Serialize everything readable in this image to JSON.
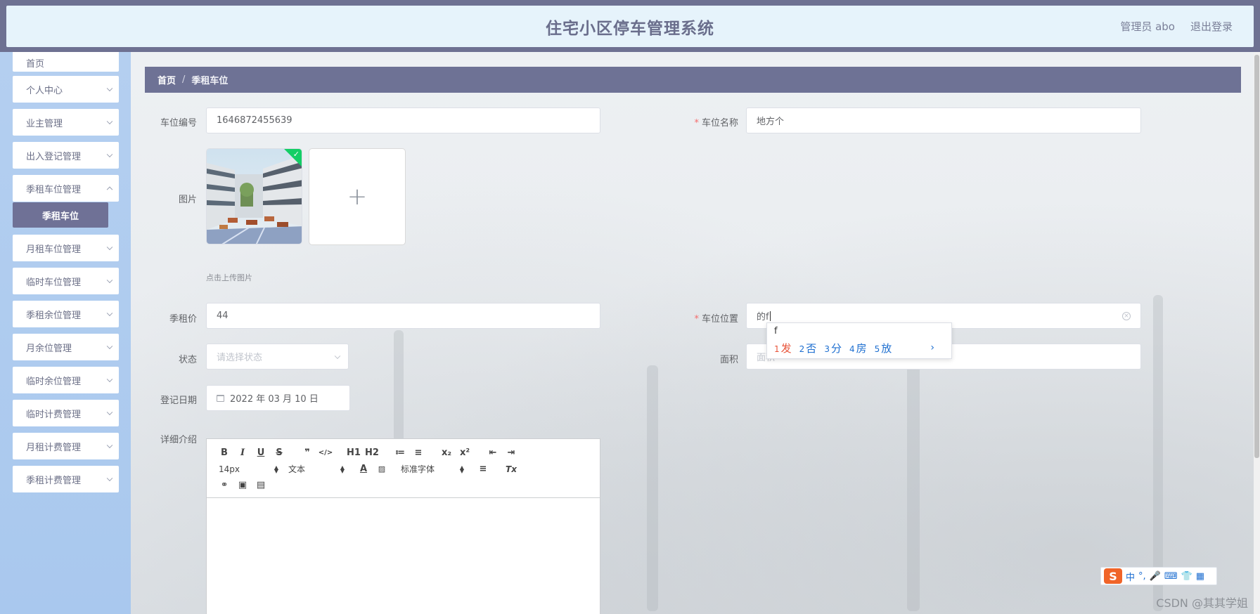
{
  "header": {
    "title": "住宅小区停车管理系统",
    "user_label": "管理员 abo",
    "logout_label": "退出登录"
  },
  "sidebar": {
    "items": [
      {
        "label": "首页"
      },
      {
        "label": "个人中心"
      },
      {
        "label": "业主管理"
      },
      {
        "label": "出入登记管理"
      },
      {
        "label": "季租车位管理"
      },
      {
        "label": "月租车位管理"
      },
      {
        "label": "临时车位管理"
      },
      {
        "label": "季租余位管理"
      },
      {
        "label": "月余位管理"
      },
      {
        "label": "临时余位管理"
      },
      {
        "label": "临时计费管理"
      },
      {
        "label": "月租计费管理"
      },
      {
        "label": "季租计费管理"
      }
    ],
    "active_sub": "季租车位"
  },
  "breadcrumb": {
    "home": "首页",
    "separator": "/",
    "current": "季租车位"
  },
  "form": {
    "code_label": "车位编号",
    "code_value": "1646872455639",
    "name_label": "车位名称",
    "name_value": "地方个",
    "image_label": "图片",
    "upload_hint": "点击上传图片",
    "price_label": "季租价",
    "price_value": "44",
    "location_label": "车位位置",
    "location_value": "的f",
    "status_label": "状态",
    "status_placeholder": "请选择状态",
    "area_label": "面积",
    "area_placeholder": "面积",
    "date_label": "登记日期",
    "date_value": "2022 年 03 月 10 日",
    "detail_label": "详细介绍",
    "required_mark": "*"
  },
  "editor": {
    "row1": [
      "B",
      "I",
      "U",
      "S",
      "❞",
      "</>",
      "H1",
      "H2",
      "≔",
      "≡",
      "x₂",
      "x²",
      "⇤",
      "⇥"
    ],
    "size_value": "14px",
    "header_value": "文本",
    "font_value": "标准字体",
    "clean_label": "Tx"
  },
  "ime": {
    "typed": "f",
    "candidates": [
      {
        "num": "1",
        "text": "发"
      },
      {
        "num": "2",
        "text": "否"
      },
      {
        "num": "3",
        "text": "分"
      },
      {
        "num": "4",
        "text": "房"
      },
      {
        "num": "5",
        "text": "放"
      }
    ],
    "more": "›"
  },
  "tray": {
    "logo": "S",
    "mode": "中",
    "punct": "°,"
  },
  "watermark": "CSDN @其其学姐",
  "colors": {
    "header_bg": "#6e7192",
    "header_inner": "#e6f3fb",
    "sidebar_bg": "#b4cff0",
    "active": "#6f7196",
    "required": "#f56c6c",
    "upload_success": "#13ce66"
  }
}
